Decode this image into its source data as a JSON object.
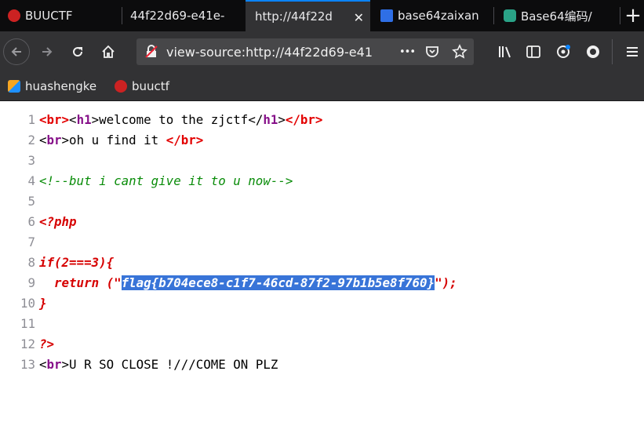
{
  "tabs": [
    {
      "label": "BUUCTF",
      "active": false
    },
    {
      "label": "44f22d69-e41e-",
      "active": false
    },
    {
      "label": "http://44f22d",
      "active": true
    },
    {
      "label": "base64zaixan",
      "active": false
    },
    {
      "label": "Base64编码/",
      "active": false
    }
  ],
  "icons": {
    "back": "back-arrow-icon",
    "forward": "forward-arrow-icon",
    "reload": "reload-icon",
    "home": "home-icon",
    "insecure": "insecure-lock-icon",
    "more": "more-actions-icon",
    "pocket": "pocket-icon",
    "star": "bookmark-star-icon",
    "library": "library-icon",
    "sidebar": "sidebar-icon",
    "extension": "extension-icon",
    "account": "account-icon",
    "menu": "hamburger-menu-icon",
    "close_tab": "close-tab-icon",
    "new_tab": "new-tab-icon"
  },
  "glyphs": {
    "more": "•••",
    "close": "✕",
    "new_tab": "+"
  },
  "url": "view-source:http://44f22d69-e41e",
  "bookmarks": [
    {
      "label": "huashengke"
    },
    {
      "label": "buuctf"
    }
  ],
  "colors": {
    "tab_accent": "#0a84ff",
    "selection": "#3874d8",
    "tag": "#861089",
    "php": "#e30000",
    "comment": "#098c09"
  },
  "source": {
    "numbers": [
      "1",
      "2",
      "3",
      "4",
      "5",
      "6",
      "7",
      "8",
      "9",
      "10",
      "11",
      "12",
      "13"
    ],
    "l1": {
      "a": "<br>",
      "b": "<",
      "c": "h1",
      "d": ">welcome to the zjctf</",
      "e": "h1",
      "f": ">",
      "g": "</br>"
    },
    "l2": {
      "a": "<",
      "b": "br",
      "c": ">oh u find it ",
      "d": "</br>"
    },
    "l4": "<!--but i cant give it to u now-->",
    "l6": "<?php",
    "l8": "if(2===3){",
    "l9": {
      "a": "  return (\"",
      "b": "flag{b704ece8-c1f7-46cd-87f2-97b1b5e8f760}",
      "c": "\");"
    },
    "l10": "}",
    "l12": "?>",
    "l13": {
      "a": "<",
      "b": "br",
      "c": ">U R SO CLOSE !///COME ON PLZ"
    }
  }
}
